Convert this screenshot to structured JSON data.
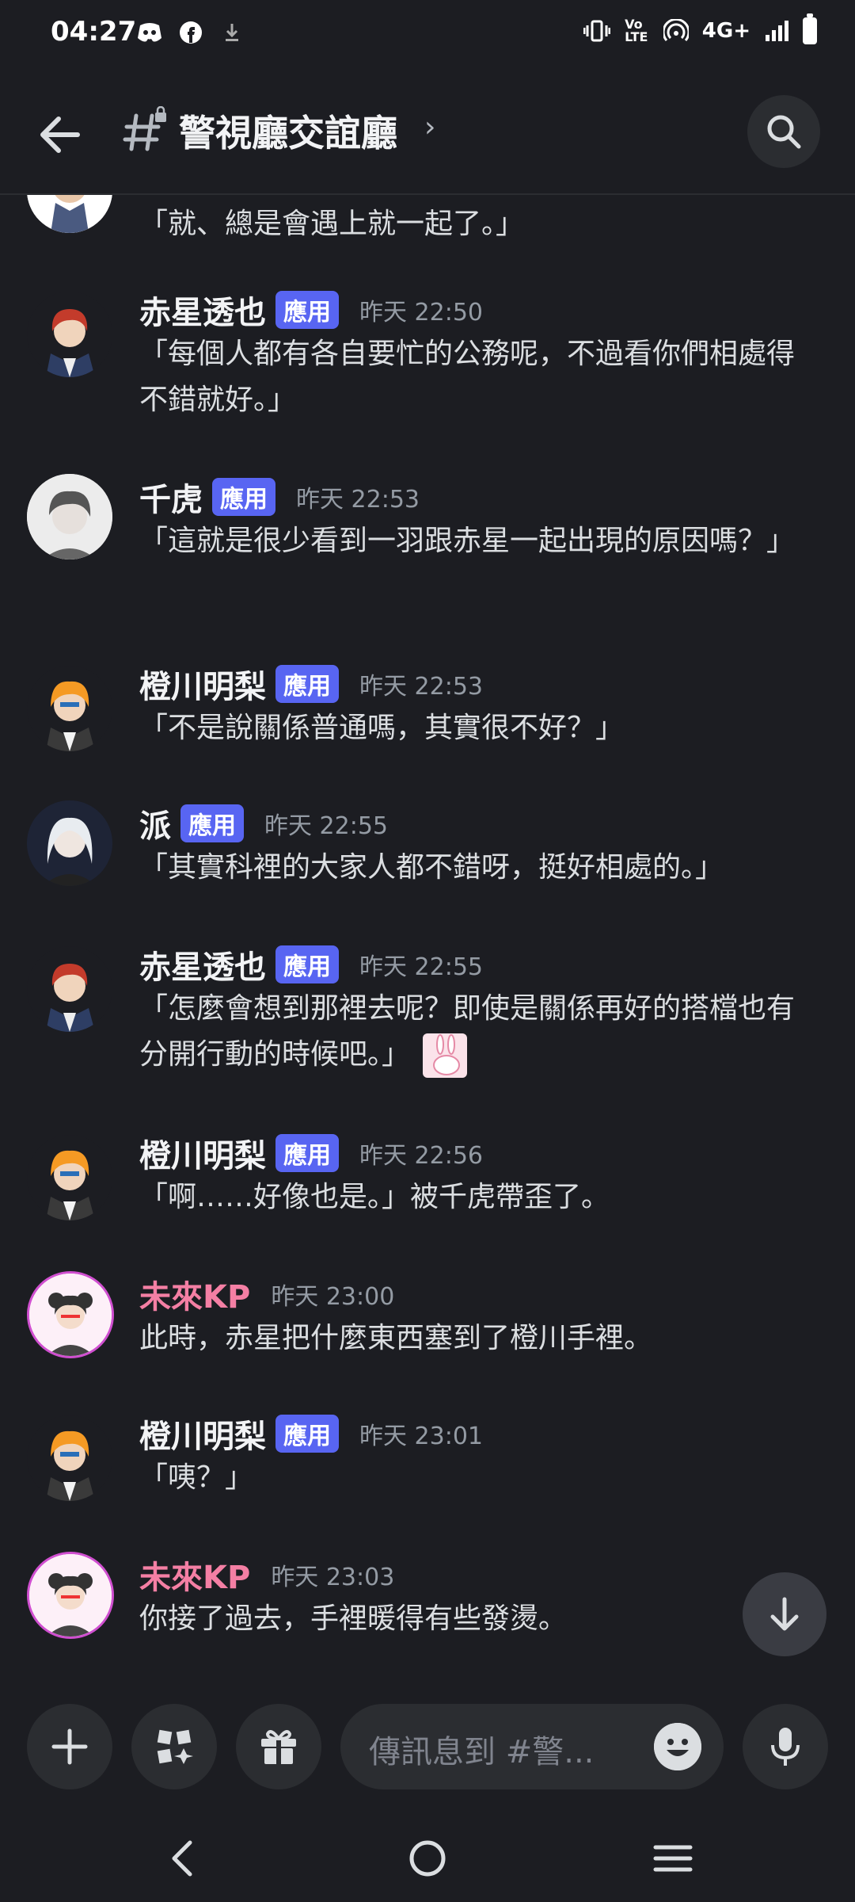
{
  "status_bar": {
    "time": "04:27",
    "left_icons": [
      "discord-icon",
      "facebook-icon",
      "download-icon"
    ],
    "network": "4G+",
    "right_icons": [
      "vibrate-icon",
      "volte-icon",
      "hotspot-icon",
      "signal-icon",
      "battery-icon"
    ]
  },
  "header": {
    "channel_name": "警視廳交誼廳",
    "icons": [
      "back-arrow-icon",
      "hash-lock-icon",
      "chevron-right-icon",
      "search-icon"
    ]
  },
  "messages": [
    {
      "id": "m0",
      "author": "",
      "badge": "",
      "time": "",
      "text": "「就、總是會遇上就一起了。」"
    },
    {
      "id": "m1",
      "author": "赤星透也",
      "badge": "應用",
      "time": "昨天 22:50",
      "text": "「每個人都有各自要忙的公務呢，不過看你們相處得不錯就好。」"
    },
    {
      "id": "m2",
      "author": "千虎",
      "badge": "應用",
      "time": "昨天 22:53",
      "text": "「這就是很少看到一羽跟赤星一起出現的原因嗎？」"
    },
    {
      "id": "m3",
      "author": "橙川明梨",
      "badge": "應用",
      "time": "昨天 22:53",
      "text": "「不是說關係普通嗎，其實很不好？」"
    },
    {
      "id": "m4",
      "author": "派",
      "badge": "應用",
      "time": "昨天 22:55",
      "text": "「其實科裡的大家人都不錯呀，挺好相處的。」"
    },
    {
      "id": "m5",
      "author": "赤星透也",
      "badge": "應用",
      "time": "昨天 22:55",
      "text": "「怎麼會想到那裡去呢？即使是關係再好的搭檔也有分開行動的時候吧。」",
      "sticker": "rabbit-sticker"
    },
    {
      "id": "m6",
      "author": "橙川明梨",
      "badge": "應用",
      "time": "昨天 22:56",
      "text": "「啊……好像也是。」被千虎帶歪了。"
    },
    {
      "id": "m7",
      "author": "未來KP",
      "badge": "",
      "time": "昨天 23:00",
      "text": "此時，赤星把什麼東西塞到了橙川手裡。"
    },
    {
      "id": "m8",
      "author": "橙川明梨",
      "badge": "應用",
      "time": "昨天 23:01",
      "text": "「咦？」"
    },
    {
      "id": "m9",
      "author": "未來KP",
      "badge": "",
      "time": "昨天 23:03",
      "text": "你接了過去，手裡暖得有些發燙。"
    }
  ],
  "composer": {
    "placeholder": "傳訊息到 #警...",
    "icons": [
      "plus-icon",
      "apps-icon",
      "gift-icon",
      "emoji-icon",
      "microphone-icon"
    ]
  },
  "jump_to_bottom_icon": "arrow-down-icon",
  "nav": {
    "icons": [
      "nav-back-icon",
      "nav-home-icon",
      "nav-recents-icon"
    ]
  },
  "colors": {
    "background": "#1c1d22",
    "badge": "#5865f2",
    "kp_name": "#f47fa4",
    "timestamp": "#949ba4"
  }
}
